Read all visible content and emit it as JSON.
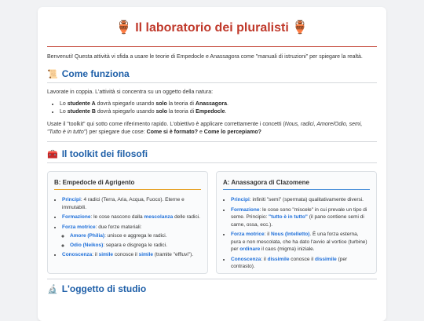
{
  "header": {
    "title": "🏺 Il laboratorio dei pluralisti 🏺"
  },
  "intro": {
    "text": "Benvenuti! Questa attività vi sfida a usare le teorie di Empedocle e Anassagora come \"manuali di istruzioni\" per spiegare la realtà."
  },
  "how": {
    "icon": "📜",
    "title": "Come funziona",
    "lead": "Lavorate in coppia. L'attività si concentra su un oggetto della natura:",
    "items": [
      {
        "pre": "Lo ",
        "who": "studente A",
        "mid": " dovrà spiegarlo usando ",
        "only": "solo",
        "post": " la teoria di ",
        "name": "Anassagora",
        "end": "."
      },
      {
        "pre": "Lo ",
        "who": "studente B",
        "mid": " dovrà spiegarlo usando ",
        "only": "solo",
        "post": " la teoria di ",
        "name": "Empedocle",
        "end": "."
      }
    ],
    "outro": {
      "t1": "Usate il \"toolkit\" qui sotto come riferimento rapido. L'obiettivo è applicare correttamente i concetti (",
      "t2": "Nous, radici, Amore/Odio, semi, \"Tutto è in tutto\"",
      "t3": ") per spiegare due cose: ",
      "q1": "Come si è formato?",
      "t4": " e ",
      "q2": "Come lo percepiamo?"
    }
  },
  "toolkit": {
    "icon": "🧰",
    "title": "Il toolkit dei filosofi",
    "b": {
      "title": "B: Empedocle di Agrigento",
      "principi_k": "Principi",
      "principi_v": ": 4 radici (Terra, Aria, Acqua, Fuoco). Eterne e immutabili.",
      "formazione_k": "Formazione",
      "formazione_v1": ": le cose nascono dalla ",
      "formazione_hl": "mescolanza",
      "formazione_v2": " delle radici.",
      "forza_k": "Forza motrice",
      "forza_v": ": due forze materiali:",
      "amore_k": "Amore (Philia)",
      "amore_v": ": unisce e aggrega le radici.",
      "odio_k": "Odio (Neikos)",
      "odio_v": ": separa e disgrega le radici.",
      "conoscenza_k": "Conoscenza",
      "conoscenza_v1": ": il ",
      "conoscenza_hl1": "simile",
      "conoscenza_v2": " conosce il ",
      "conoscenza_hl2": "simile",
      "conoscenza_v3": " (tramite \"effluvi\")."
    },
    "a": {
      "title": "A: Anassagora di Clazomene",
      "principi_k": "Principi",
      "principi_v": ": infiniti \"semi\" (spermata) qualitativamente diversi.",
      "formazione_k": "Formazione",
      "formazione_v1": ": le cose sono \"miscele\" in cui prevale un tipo di seme. Principio: ",
      "formazione_hl": "\"tutto è in tutto\"",
      "formazione_v2": " (il pane contiene semi di carne, ossa, ecc.).",
      "forza_k": "Forza motrice",
      "forza_v1": ": il ",
      "forza_hl1": "Nous (Intelletto)",
      "forza_v2": ". È una forza esterna, pura e non mescolata, che ha dato l'avvio al vortice (turbine) per ",
      "forza_hl2": "ordinare",
      "forza_v3": " il caos (migma) iniziale.",
      "conoscenza_k": "Conoscenza",
      "conoscenza_v1": ": il ",
      "conoscenza_hl1": "dissimile",
      "conoscenza_v2": " conosce il ",
      "conoscenza_hl2": "dissimile",
      "conoscenza_v3": " (per contrasto)."
    }
  },
  "study": {
    "icon": "🔬",
    "title": "L'oggetto di studio"
  }
}
